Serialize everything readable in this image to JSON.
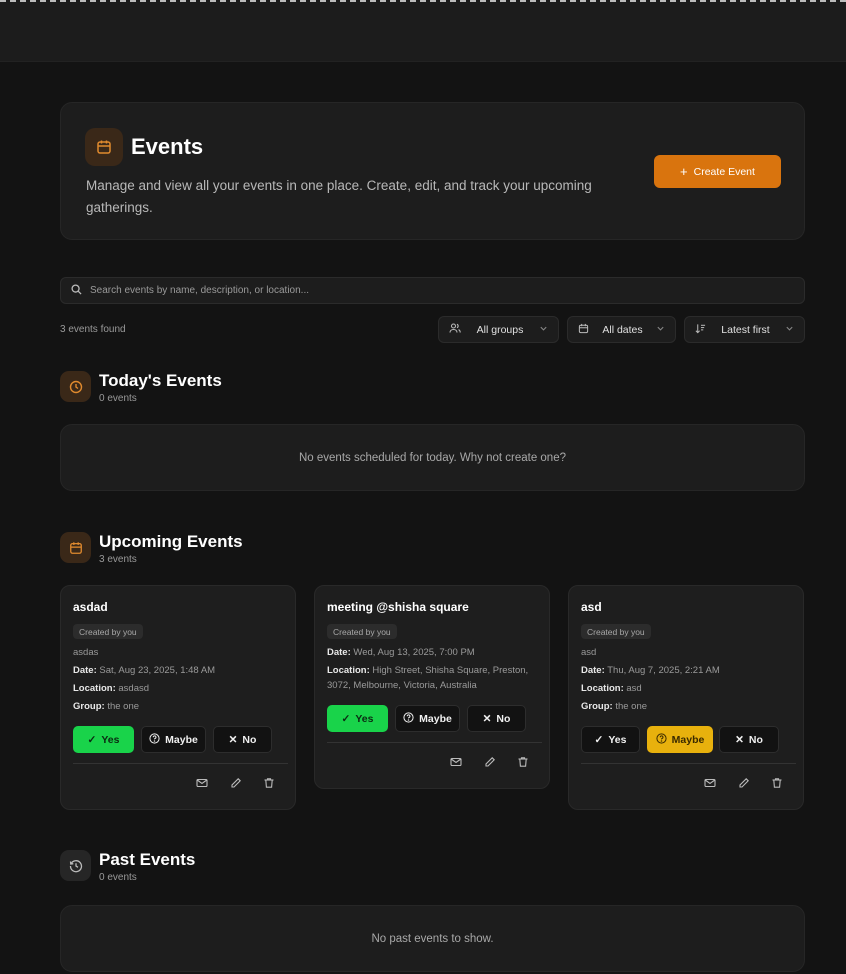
{
  "header": {
    "title": "Events",
    "description": "Manage and view all your events in one place. Create, edit, and track your upcoming gatherings.",
    "create_label": "Create Event",
    "accent_color": "#d9740e"
  },
  "search": {
    "placeholder": "Search events by name, description, or location..."
  },
  "results": {
    "found_label": "3 events found"
  },
  "filters": {
    "group": "All groups",
    "date": "All dates",
    "sort": "Latest first"
  },
  "sections": {
    "today": {
      "title": "Today's Events",
      "count": "0 events",
      "empty": "No events scheduled for today. Why not create one?"
    },
    "upcoming": {
      "title": "Upcoming Events",
      "count": "3 events"
    },
    "past": {
      "title": "Past Events",
      "count": "0 events",
      "empty": "No past events to show."
    }
  },
  "events": [
    {
      "title": "asdad",
      "badge": "Created by you",
      "description": "asdas",
      "date_label": "Date:",
      "date": "Sat, Aug 23, 2025, 1:48 AM",
      "location_label": "Location:",
      "location": "asdasd",
      "group_label": "Group:",
      "group": "the one",
      "rsvp": "yes"
    },
    {
      "title": "meeting @shisha square",
      "badge": "Created by you",
      "date_label": "Date:",
      "date": "Wed, Aug 13, 2025, 7:00 PM",
      "location_label": "Location:",
      "location": "High Street, Shisha Square, Preston, 3072, Melbourne, Victoria, Australia",
      "rsvp": "yes"
    },
    {
      "title": "asd",
      "badge": "Created by you",
      "description": "asd",
      "date_label": "Date:",
      "date": "Thu, Aug 7, 2025, 2:21 AM",
      "location_label": "Location:",
      "location": "asd",
      "group_label": "Group:",
      "group": "the one",
      "rsvp": "maybe"
    }
  ],
  "rsvp_labels": {
    "yes": "Yes",
    "maybe": "Maybe",
    "no": "No"
  },
  "colors": {
    "yes_active": "#19d34a",
    "maybe_active": "#e8b10d"
  }
}
